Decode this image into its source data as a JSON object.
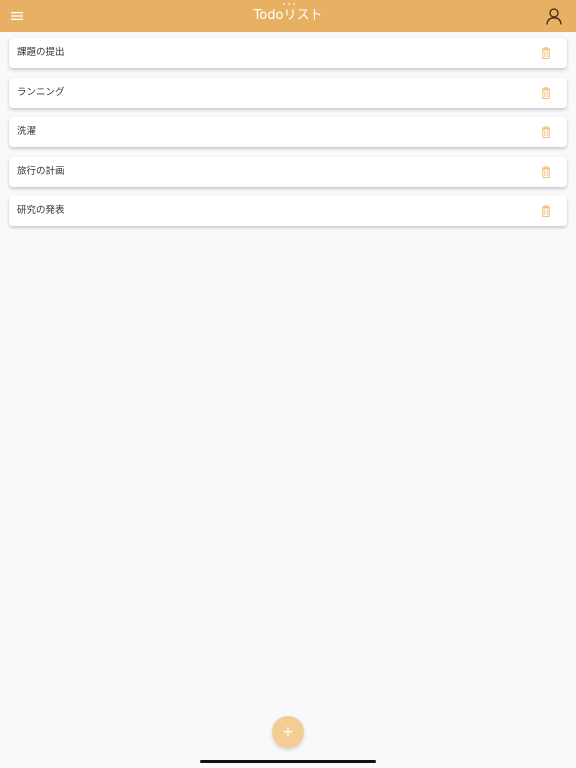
{
  "app": {
    "title": "Todoリスト",
    "accent_color": "#e8b063",
    "icons": {
      "menu": "hamburger-menu-icon",
      "account": "user-account-icon",
      "delete": "trash-icon",
      "add": "plus-icon"
    }
  },
  "todos": [
    {
      "label": "課題の提出"
    },
    {
      "label": "ランニング"
    },
    {
      "label": "洗濯"
    },
    {
      "label": "旅行の計画"
    },
    {
      "label": "研究の発表"
    }
  ],
  "fab": {
    "symbol": "+"
  }
}
